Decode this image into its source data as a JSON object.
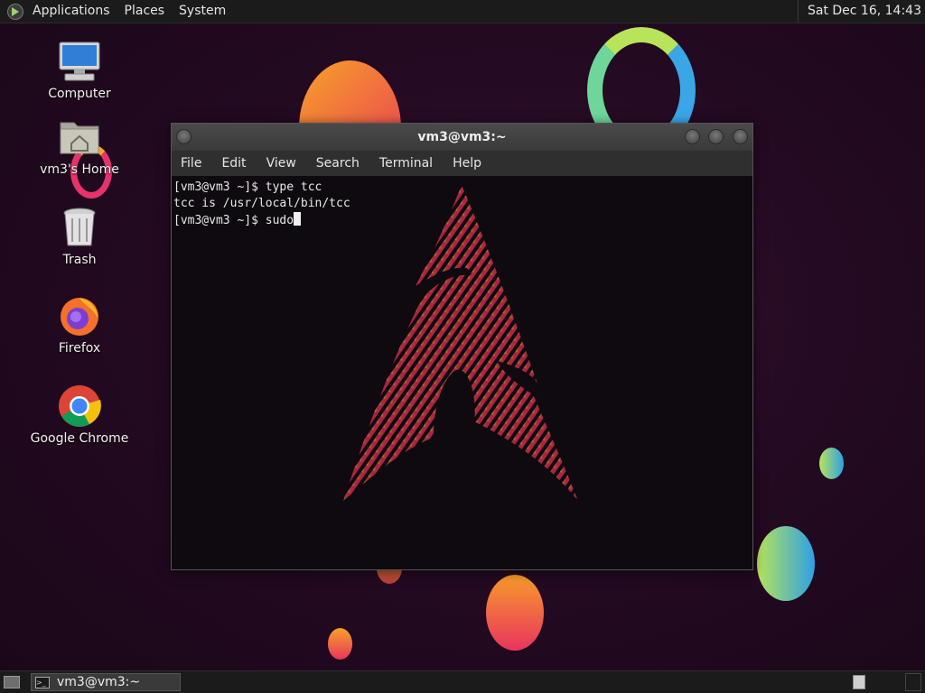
{
  "top_panel": {
    "menus": [
      "Applications",
      "Places",
      "System"
    ],
    "clock": "Sat Dec 16, 14:43"
  },
  "desktop_icons": [
    {
      "label": "Computer",
      "icon": "computer-icon"
    },
    {
      "label": "vm3's Home",
      "icon": "home-folder-icon"
    },
    {
      "label": "Trash",
      "icon": "trash-icon"
    },
    {
      "label": "Firefox",
      "icon": "firefox-icon"
    },
    {
      "label": "Google Chrome",
      "icon": "chrome-icon"
    }
  ],
  "terminal": {
    "title": "vm3@vm3:~",
    "menus": [
      "File",
      "Edit",
      "View",
      "Search",
      "Terminal",
      "Help"
    ],
    "lines": [
      "[vm3@vm3 ~]$ type tcc",
      "tcc is /usr/local/bin/tcc",
      "[vm3@vm3 ~]$ sudo"
    ]
  },
  "taskbar": {
    "tasks": [
      {
        "label": "vm3@vm3:~",
        "icon": "terminal-icon"
      }
    ]
  },
  "colors": {
    "panel": "#1b1b1b",
    "wallpaper": "#240a22",
    "terminal_bg": "#0f0a10"
  }
}
